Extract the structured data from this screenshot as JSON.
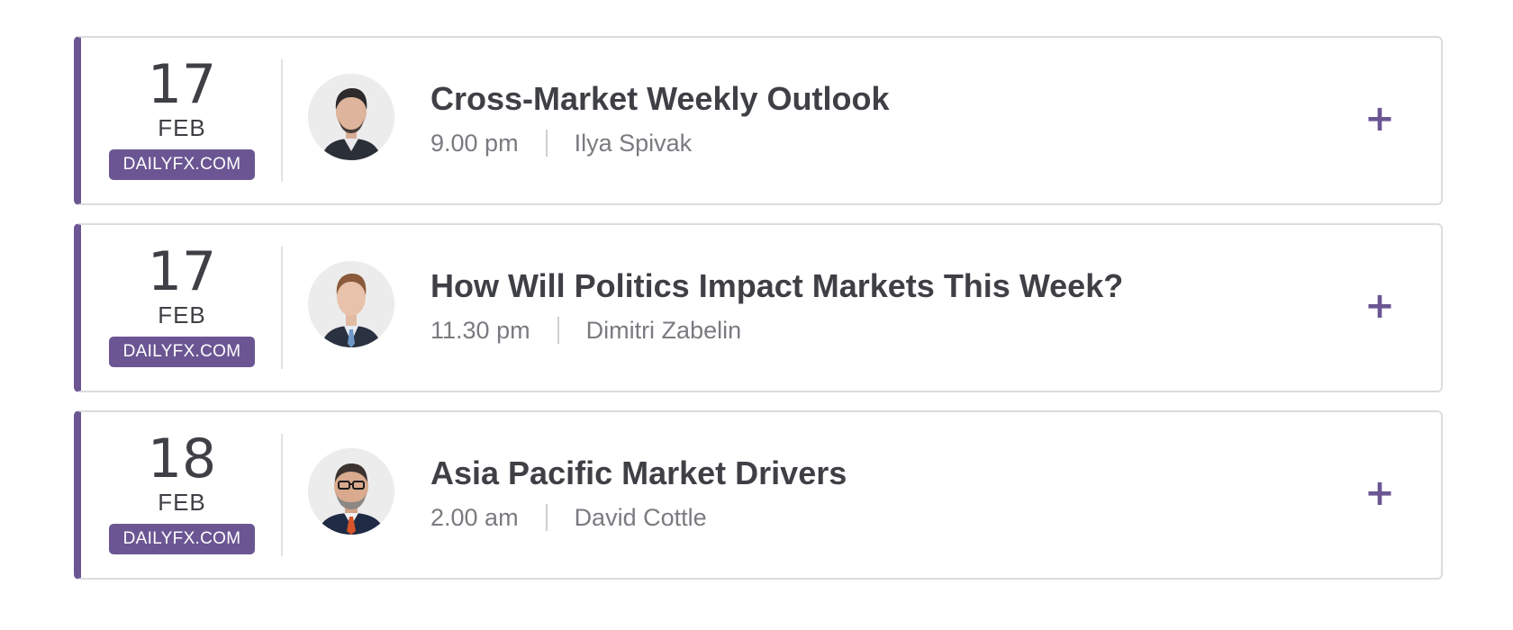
{
  "events": [
    {
      "day": "17",
      "month": "FEB",
      "source": "DAILYFX.COM",
      "title": "Cross-Market Weekly Outlook",
      "time": "9.00 pm",
      "presenter": "Ilya Spivak",
      "avatar_icon": "presenter-photo"
    },
    {
      "day": "17",
      "month": "FEB",
      "source": "DAILYFX.COM",
      "title": "How Will Politics Impact Markets This Week?",
      "time": "11.30 pm",
      "presenter": "Dimitri Zabelin",
      "avatar_icon": "presenter-photo"
    },
    {
      "day": "18",
      "month": "FEB",
      "source": "DAILYFX.COM",
      "title": "Asia Pacific Market Drivers",
      "time": "2.00 am",
      "presenter": "David Cottle",
      "avatar_icon": "presenter-photo"
    }
  ],
  "expand_icon": "plus-icon",
  "colors": {
    "accent": "#6b5693",
    "text": "#3f4045",
    "meta": "#7a7b80",
    "border": "#dcdcdc"
  }
}
